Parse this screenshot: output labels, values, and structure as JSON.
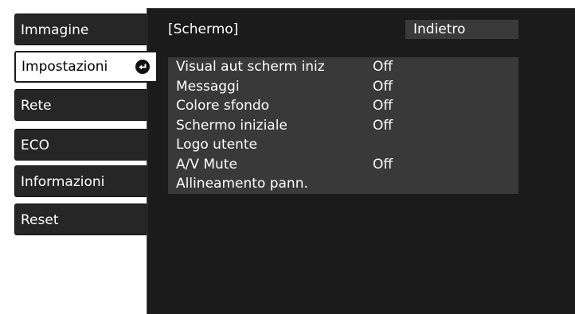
{
  "sidebar": {
    "items": [
      {
        "label": "Immagine"
      },
      {
        "label": "Impostazioni"
      },
      {
        "label": "Rete"
      },
      {
        "label": "ECO"
      },
      {
        "label": "Informazioni"
      },
      {
        "label": "Reset"
      }
    ],
    "selected_icon": "enter-arrow-icon"
  },
  "panel": {
    "title": "[Schermo]",
    "back_label": "Indietro",
    "rows": [
      {
        "label": "Visual aut scherm iniz",
        "value": "Off"
      },
      {
        "label": "Messaggi",
        "value": "Off"
      },
      {
        "label": "Colore sfondo",
        "value": "Off"
      },
      {
        "label": "Schermo iniziale",
        "value": "Off"
      },
      {
        "label": "Logo utente",
        "value": ""
      },
      {
        "label": "A/V Mute",
        "value": "Off"
      },
      {
        "label": "Allineamento pann.",
        "value": ""
      }
    ]
  },
  "colors": {
    "panel_bg": "#1b1b1b",
    "sidebar_bg": "#262626",
    "row_bg": "#393939",
    "text": "#ffffff"
  }
}
